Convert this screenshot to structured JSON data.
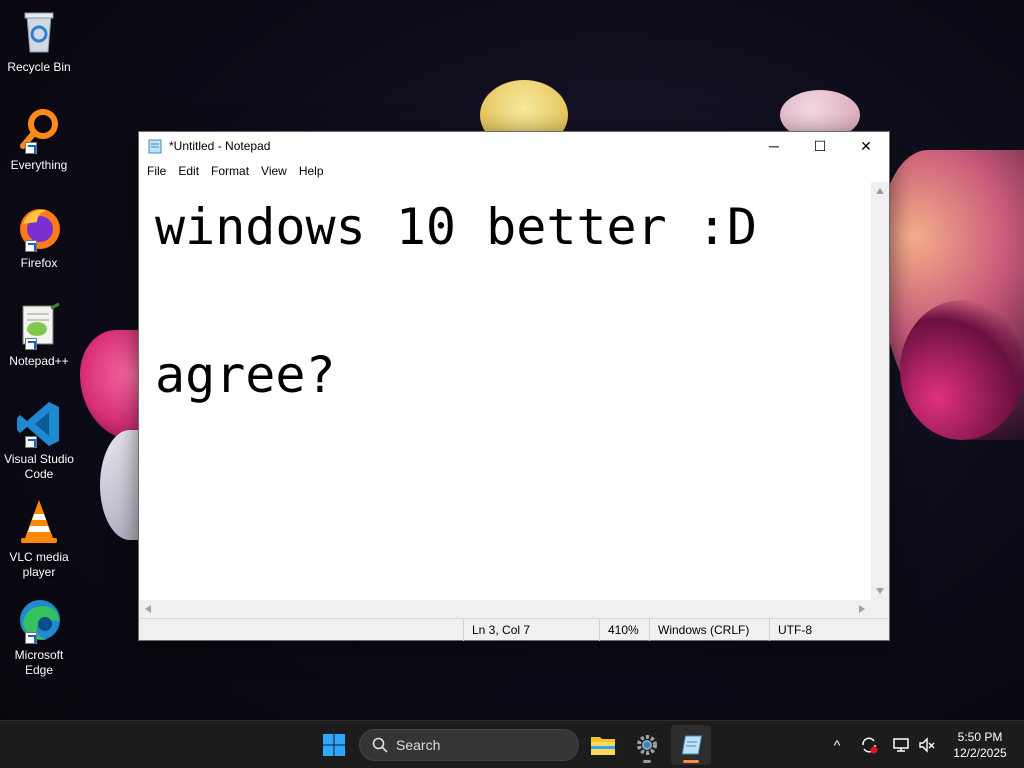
{
  "desktop": {
    "icons": [
      {
        "label": "Recycle Bin"
      },
      {
        "label": "Everything"
      },
      {
        "label": "Firefox"
      },
      {
        "label": "Notepad++"
      },
      {
        "label": "Visual Studio Code"
      },
      {
        "label": "VLC media player"
      },
      {
        "label": "Microsoft Edge"
      }
    ]
  },
  "notepad": {
    "title": "*Untitled - Notepad",
    "menu": [
      "File",
      "Edit",
      "Format",
      "View",
      "Help"
    ],
    "content": "windows 10 better :D\n\nagree?",
    "status": {
      "position": "Ln 3, Col 7",
      "zoom": "410%",
      "line_ending": "Windows (CRLF)",
      "encoding": "UTF-8"
    },
    "buttons": {
      "minimize": "─",
      "maximize": "☐",
      "close": "✕"
    }
  },
  "taskbar": {
    "search_label": "Search",
    "clock": {
      "time": "5:50 PM",
      "date": "12/2/2025"
    },
    "tray_chevron": "^"
  },
  "colors": {
    "accent": "#ff8a3d",
    "taskbar": "#1c1c1c",
    "win_blue": "#0a84ff"
  }
}
